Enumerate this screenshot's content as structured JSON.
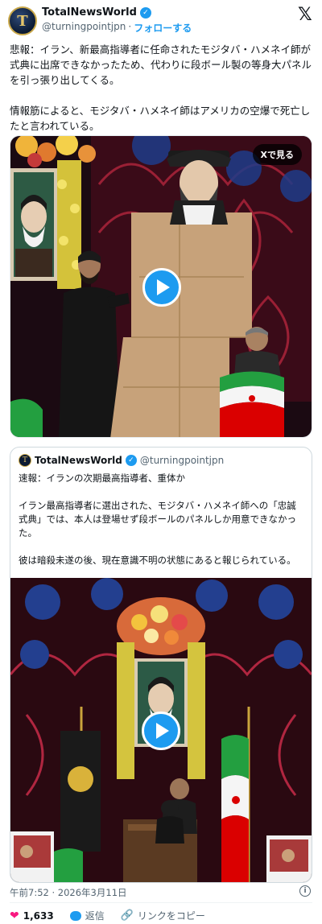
{
  "author": {
    "avatar_letter": "T",
    "name": "TotalNewsWorld",
    "handle": "@turningpointjpn",
    "separator": "·",
    "follow_label": "フォローする"
  },
  "x_logo": "𝕏",
  "tweet": {
    "text": "悲報：イラン、新最高指導者に任命されたモジタバ・ハメネイ師が式典に出席できなかったため、代わりに段ボール製の等身大パネルを引っ張り出してくる。\n\n情報筋によると、モジタバ・ハメネイ師はアメリカの空爆で死亡したと言われている。"
  },
  "media1": {
    "view_on_x_label": "Xで見る"
  },
  "quoted": {
    "avatar_letter": "T",
    "name": "TotalNewsWorld",
    "handle": "@turningpointjpn",
    "text": "速報：イランの次期最高指導者、重体か\n\nイラン最高指導者に選出された、モジタバ・ハメネイ師への「忠誠式典」では、本人は登場せず段ボールのパネルしか用意できなかった。\n\n彼は暗殺未遂の後、現在意識不明の状態にあると報じられている。"
  },
  "timestamp": "午前7:52 · 2026年3月11日",
  "actions": {
    "likes_count": "1,633",
    "reply_label": "返信",
    "copy_link_label": "リンクをコピー"
  },
  "colors": {
    "accent": "#1d9bf0",
    "like": "#f91880",
    "muted": "#536471"
  }
}
